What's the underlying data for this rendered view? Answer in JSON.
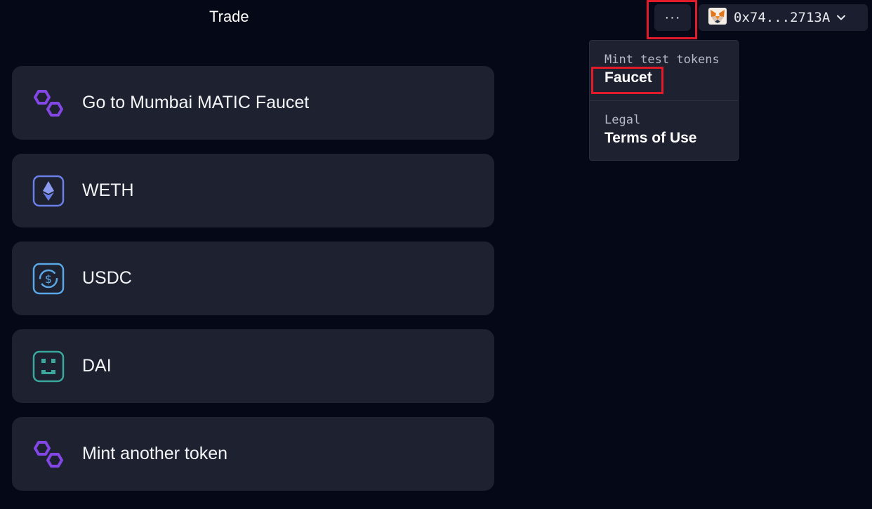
{
  "nav": {
    "title": "Trade",
    "more_label": "···"
  },
  "wallet": {
    "address": "0x74...2713A",
    "icon": "metamask-fox-icon"
  },
  "dropdown": {
    "sections": [
      {
        "caption": "Mint test tokens",
        "link": "Faucet"
      },
      {
        "caption": "Legal",
        "link": "Terms of Use"
      }
    ]
  },
  "tokens": [
    {
      "label": "Go to Mumbai MATIC Faucet",
      "icon": "polygon-icon"
    },
    {
      "label": "WETH",
      "icon": "ethereum-icon"
    },
    {
      "label": "USDC",
      "icon": "usdc-icon"
    },
    {
      "label": "DAI",
      "icon": "dai-icon"
    },
    {
      "label": "Mint another token",
      "icon": "polygon-icon"
    }
  ],
  "colors": {
    "background": "#050816",
    "card": "#1e2130",
    "highlight": "#e21b2b",
    "polygon": "#8247e5",
    "ethereum": "#6b7fe8",
    "usdc": "#5aa7e6",
    "dai": "#3aa89c"
  }
}
